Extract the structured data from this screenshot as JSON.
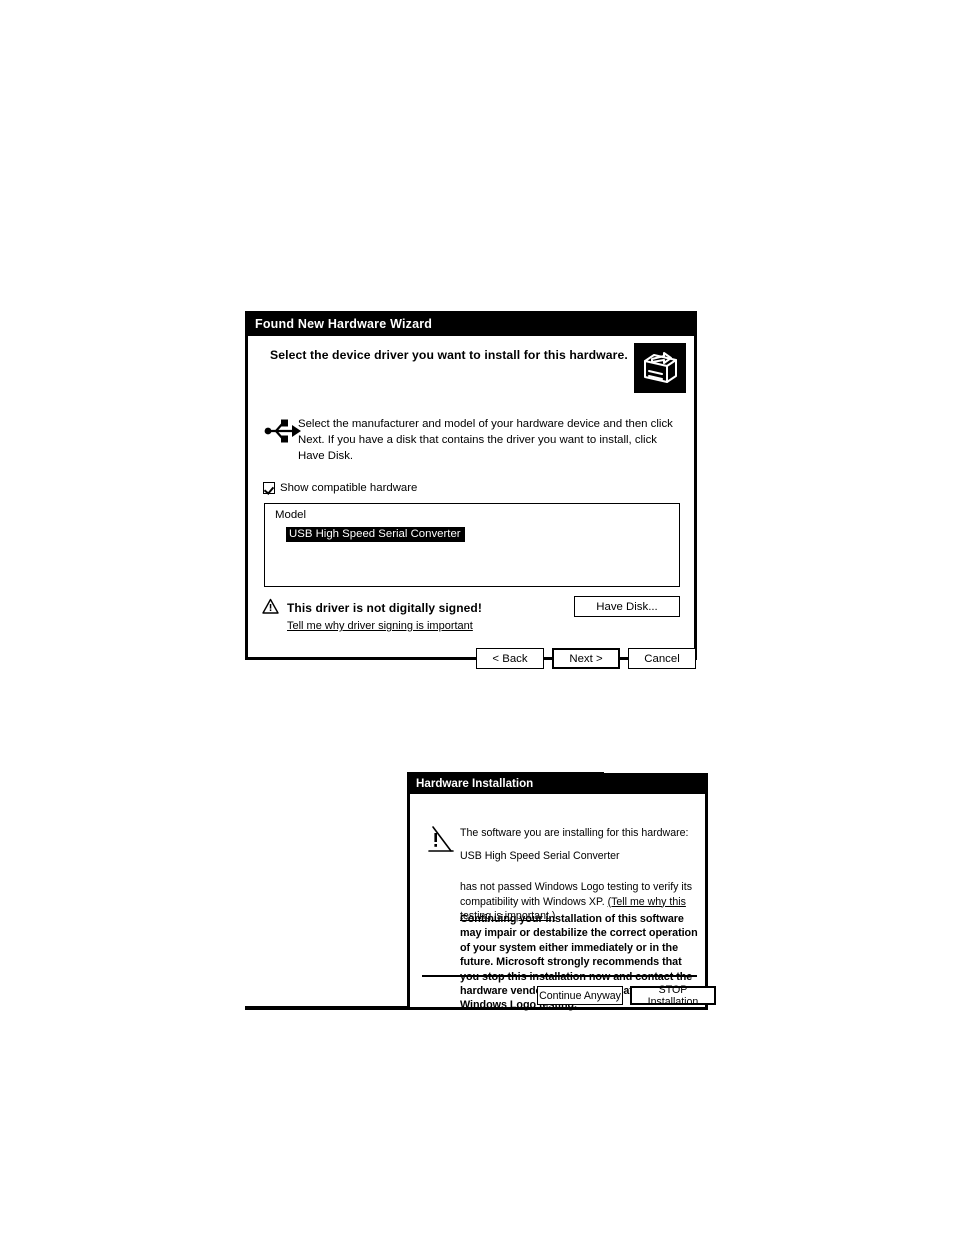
{
  "page": {
    "background": "#ffffff",
    "ink_color": "#000000"
  },
  "wizard_dialog": {
    "title": "Found New Hardware Wizard",
    "heading": "Select the device driver you want to install for this hardware.",
    "header_graphic_icon": "hardware-card-icon",
    "device_icon": "usb-trident-icon",
    "instructions": "Select the manufacturer and model of your hardware device and then click Next. If you have a disk that contains the driver you want to install, click Have Disk.",
    "show_compatible": {
      "label": "Show compatible hardware",
      "checked": true
    },
    "model_list": {
      "column_header": "Model",
      "items": [
        {
          "label": "USB High Speed Serial Converter",
          "selected": true
        }
      ]
    },
    "driver_signing": {
      "icon": "warning-triangle-icon",
      "title": "This driver is not digitally signed!",
      "link": "Tell me why driver signing is important"
    },
    "have_disk_label": "Have Disk...",
    "nav_buttons": [
      {
        "label": "< Back",
        "default": false
      },
      {
        "label": "Next >",
        "default": true
      },
      {
        "label": "Cancel",
        "default": false
      }
    ]
  },
  "hardware_installation_dialog": {
    "title": "Hardware Installation",
    "icon": "warning-exclamation-icon",
    "intro": "The software you are installing for this hardware:",
    "device_name": "USB High Speed Serial Converter",
    "logo_text_prefix": "has not passed Windows Logo testing to verify its compatibility with Windows XP. ",
    "logo_text_link": "(Tell me why this testing is important.)",
    "bold_warning": "Continuing your installation of this software may impair or destabilize the correct operation of your system either immediately or in the future. Microsoft strongly recommends that you stop this installation now and contact the hardware vendor for software that has passed Windows Logo testing.",
    "buttons": [
      {
        "label": "Continue Anyway",
        "default": false
      },
      {
        "label": "STOP Installation",
        "default": true
      }
    ]
  }
}
